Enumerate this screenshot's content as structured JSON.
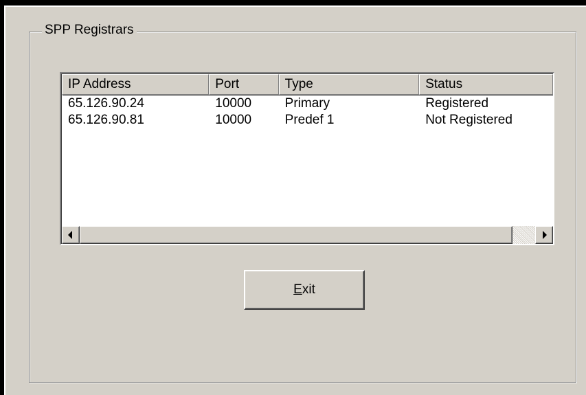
{
  "groupbox": {
    "title": "SPP Registrars"
  },
  "listview": {
    "columns": [
      "IP Address",
      "Port",
      "Type",
      "Status"
    ],
    "rows": [
      {
        "ip": "65.126.90.24",
        "port": "10000",
        "type": "Primary",
        "status": "Registered"
      },
      {
        "ip": "65.126.90.81",
        "port": "10000",
        "type": "Predef 1",
        "status": "Not Registered"
      }
    ]
  },
  "buttons": {
    "exit_mnemonic": "E",
    "exit_rest": "xit"
  },
  "icons": {
    "scroll_left": "arrow-left-icon",
    "scroll_right": "arrow-right-icon"
  }
}
